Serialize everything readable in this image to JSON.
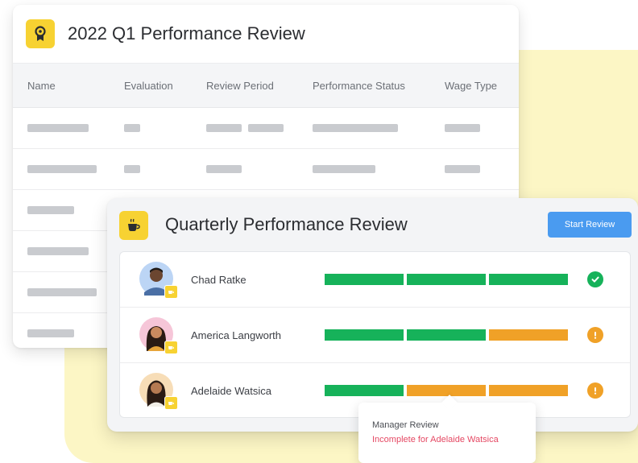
{
  "back_card": {
    "title": "2022 Q1 Performance Review",
    "badge_icon": "ribbon-award-icon",
    "columns": [
      "Name",
      "Evaluation",
      "Review Period",
      "Performance Status",
      "Wage Type"
    ]
  },
  "front_card": {
    "title": "Quarterly Performance Review",
    "badge_icon": "coffee-cup-icon",
    "start_button_label": "Start Review",
    "people": [
      {
        "name": "Chad Ratke",
        "progress": [
          "green",
          "green",
          "green"
        ],
        "status": "complete"
      },
      {
        "name": "America Langworth",
        "progress": [
          "green",
          "green",
          "orange"
        ],
        "status": "warning"
      },
      {
        "name": "Adelaide Watsica",
        "progress": [
          "green",
          "orange",
          "orange"
        ],
        "status": "warning"
      }
    ]
  },
  "tooltip": {
    "title": "Manager Review",
    "message": "Incomplete for Adelaide Watsica"
  },
  "colors": {
    "accent_yellow": "#f7d232",
    "primary_button": "#4a9bf0",
    "progress_green": "#16b25a",
    "progress_orange": "#f0a127",
    "error_text": "#e54863",
    "background_blob": "#fcf6c5"
  }
}
